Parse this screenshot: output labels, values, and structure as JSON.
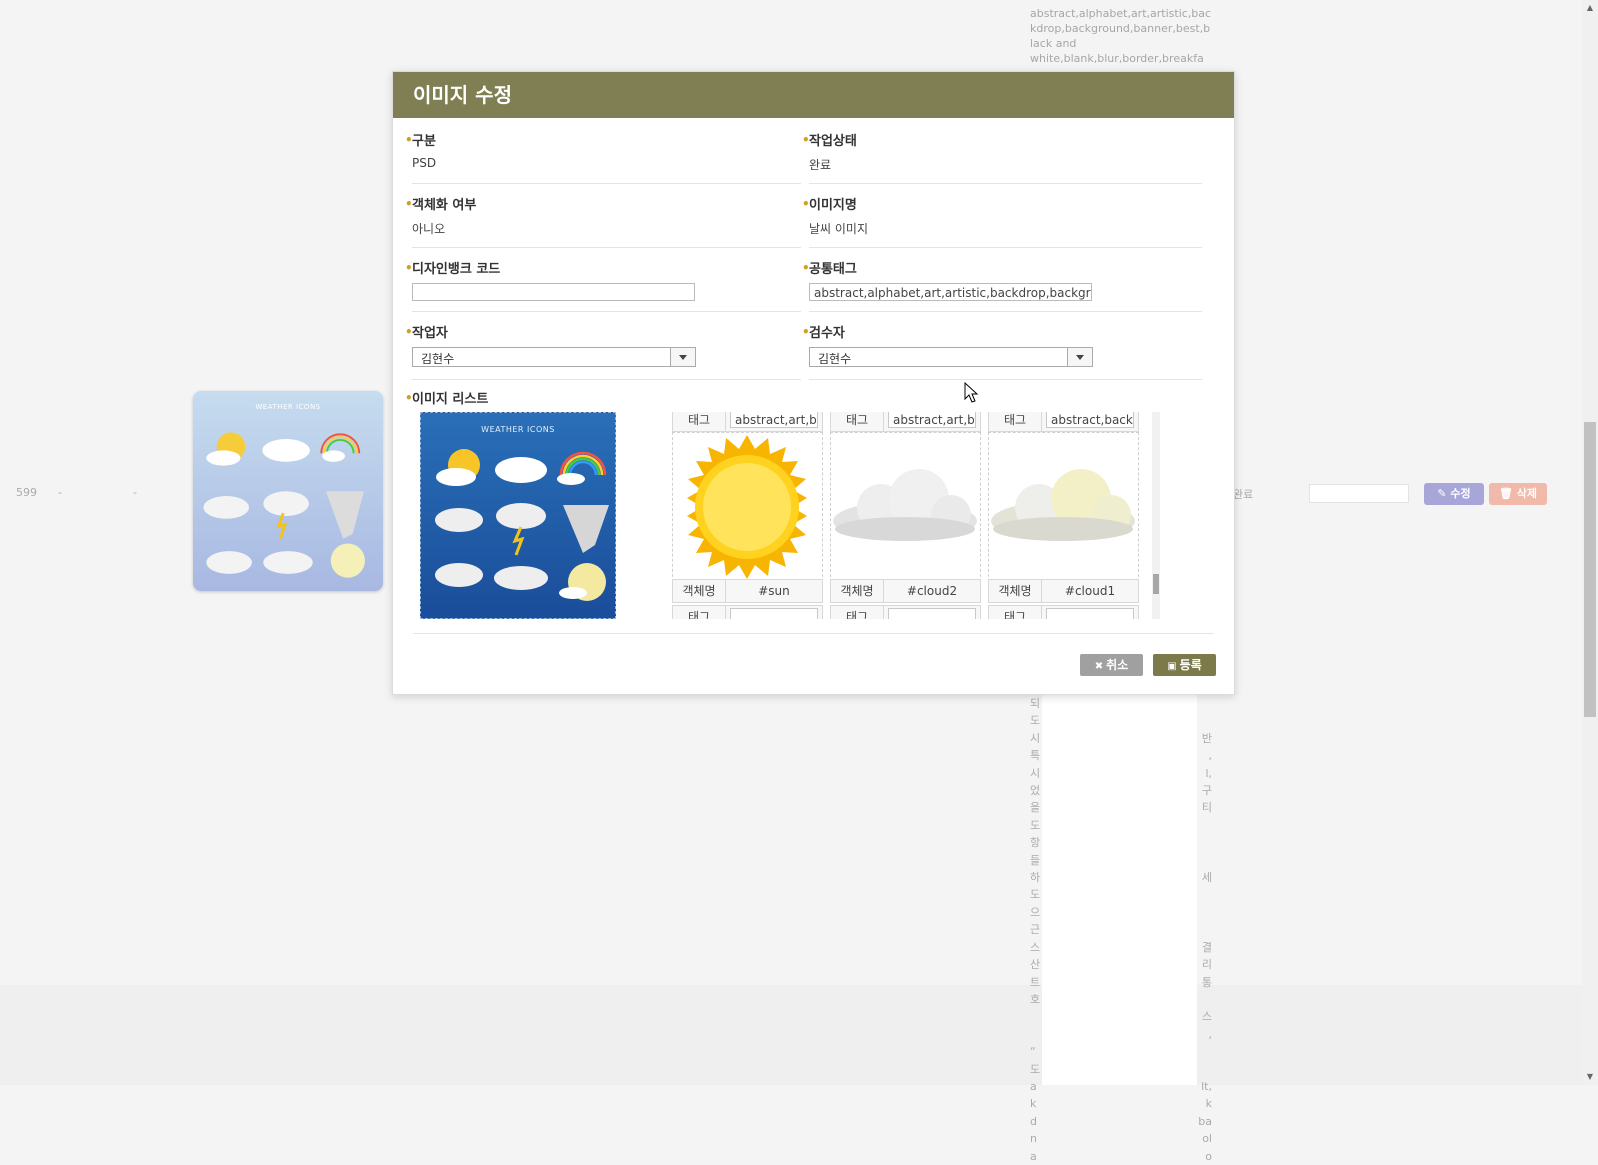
{
  "background": {
    "tags_text": "abstract,alphabet,art,artistic,backdrop,background,banner,best,black and white,blank,blur,border,breakfa",
    "row_number": "599",
    "row_dash1": "-",
    "row_dash2": "-",
    "row_status": "완료",
    "edit_label": "수정",
    "delete_label": "삭제",
    "thumb_title": "WEATHER ICONS",
    "column_left_chars": [
      "되",
      "도",
      "시",
      "특",
      "시",
      "었",
      "을",
      "도",
      "항",
      "들",
      "하",
      "도",
      "으",
      "근",
      "스",
      "산",
      "트",
      "호",
      "",
      "",
      "“",
      "도",
      "a",
      "k",
      "d",
      "n",
      "a"
    ],
    "column_right_chars": [
      "",
      "",
      "반",
      ",",
      "l,",
      "구",
      "티",
      "",
      "",
      "",
      "세",
      "",
      "",
      "",
      "결",
      "리",
      "통",
      "",
      "스",
      ",",
      "",
      "",
      "lt,",
      "k",
      "ba",
      "ol",
      "o"
    ]
  },
  "modal": {
    "title": "이미지 수정",
    "fields": {
      "category": {
        "label": "구분",
        "value": "PSD"
      },
      "work_status": {
        "label": "작업상태",
        "value": "완료"
      },
      "objectified": {
        "label": "객체화 여부",
        "value": "아니오"
      },
      "image_name": {
        "label": "이미지명",
        "value": "날씨 이미지"
      },
      "designbank_code": {
        "label": "디자인뱅크 코드",
        "value": ""
      },
      "common_tags": {
        "label": "공통태그",
        "value": "abstract,alphabet,art,artistic,backdrop,background"
      },
      "worker": {
        "label": "작업자",
        "value": "김현수"
      },
      "reviewer": {
        "label": "검수자",
        "value": "김현수"
      }
    },
    "image_list_label": "이미지 리스트",
    "main_image_title": "WEATHER ICONS",
    "cards": [
      {
        "tag_key": "태그",
        "tag_value": "abstract,art,ba",
        "obj_key": "객체명",
        "obj_value": "#sun",
        "next_key": "태그"
      },
      {
        "tag_key": "태그",
        "tag_value": "abstract,art,ba",
        "obj_key": "객체명",
        "obj_value": "#cloud2",
        "next_key": "태그"
      },
      {
        "tag_key": "태그",
        "tag_value": "abstract,backg",
        "obj_key": "객체명",
        "obj_value": "#cloud1",
        "next_key": "태그"
      }
    ],
    "cancel_label": "취소",
    "save_label": "등록"
  },
  "colors": {
    "header": "#807e53",
    "save_button": "#7c7a4a",
    "cancel_button": "#a0a0a0",
    "required_dot": "#c9a227",
    "edit_button": "#a8a6d8",
    "delete_button": "#f0b9a9"
  }
}
